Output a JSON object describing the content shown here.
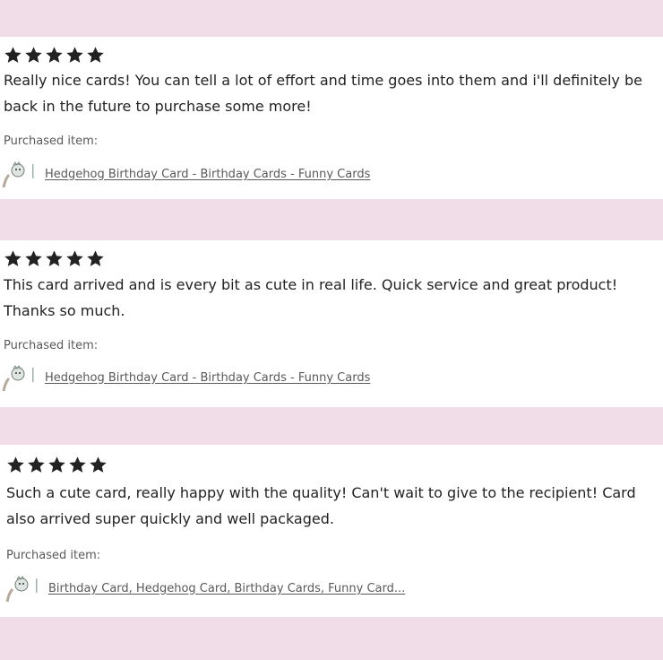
{
  "reviews": [
    {
      "rating": 5,
      "text": "Really nice cards! You can tell a lot of effort and time goes into them and i'll definitely be back in the future to purchase some more!",
      "purchased_label": "Purchased item:",
      "item_link": "Hedgehog Birthday Card - Birthday Cards - Funny Cards",
      "thumbnail": "hedgehog-card-thumbnail"
    },
    {
      "rating": 5,
      "text": "This card arrived and is every bit as cute in real life. Quick service and great product! Thanks so much.",
      "purchased_label": "Purchased item:",
      "item_link": "Hedgehog Birthday Card - Birthday Cards - Funny Cards",
      "thumbnail": "hedgehog-card-thumbnail"
    },
    {
      "rating": 5,
      "text": "Such a cute card, really happy with the quality! Can't wait to give to the recipient! Card also arrived super quickly and well packaged.",
      "purchased_label": "Purchased item:",
      "item_link": "Birthday Card, Hedgehog Card, Birthday Cards, Funny Card...",
      "thumbnail": "hedgehog-card-thumbnail"
    }
  ],
  "colors": {
    "background": "#f0dde8",
    "card": "#ffffff",
    "star": "#222222",
    "text": "#222222",
    "muted": "#595959"
  },
  "icons": {
    "star": "star-icon"
  }
}
